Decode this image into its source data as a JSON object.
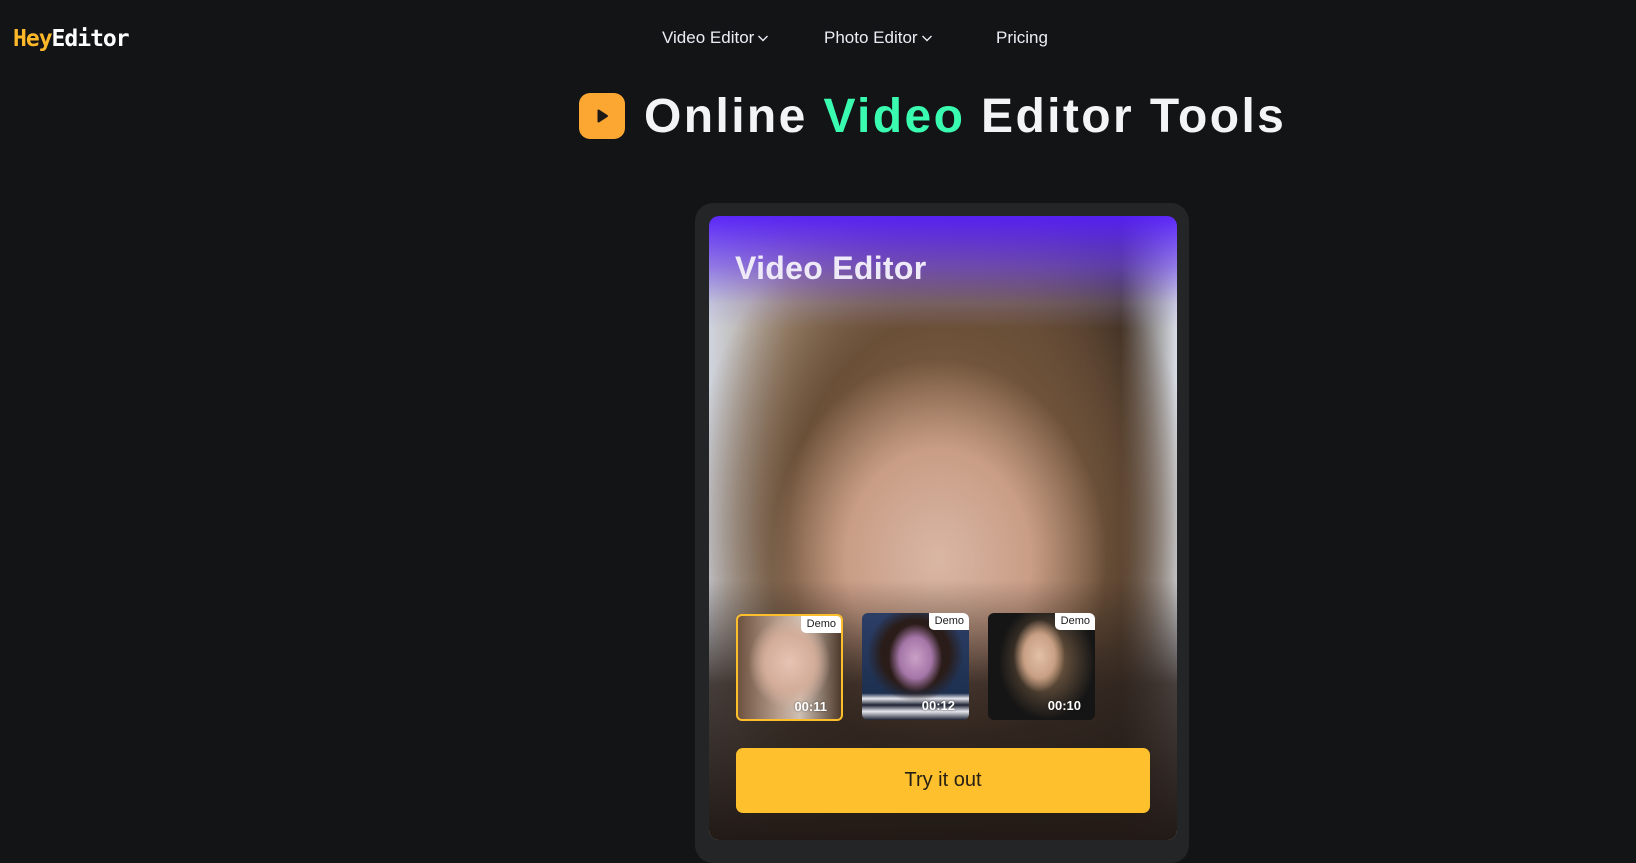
{
  "header": {
    "logo": {
      "part1": "Hey",
      "part2": "Editor"
    },
    "nav": [
      {
        "label": "Video Editor",
        "icon": "chevron-down-icon",
        "has_dropdown": true
      },
      {
        "label": "Photo Editor",
        "icon": "chevron-down-icon",
        "has_dropdown": true
      },
      {
        "label": "Pricing",
        "has_dropdown": false
      }
    ]
  },
  "hero": {
    "icon": "play-icon",
    "title_before": "Online ",
    "title_accent": "Video",
    "title_after": " Editor Tools"
  },
  "card": {
    "title": "Video Editor",
    "thumbnails": [
      {
        "badge": "Demo",
        "duration": "00:11",
        "selected": true
      },
      {
        "badge": "Demo",
        "duration": "00:12",
        "selected": false
      },
      {
        "badge": "Demo",
        "duration": "00:10",
        "selected": false
      }
    ],
    "cta_label": "Try it out"
  },
  "colors": {
    "background": "#131416",
    "brand_yellow": "#fdb82a",
    "accent_green": "#3afcb0",
    "icon_orange": "#fda733",
    "button_yellow": "#fec02c",
    "card_gradient_top": "#551efa"
  }
}
